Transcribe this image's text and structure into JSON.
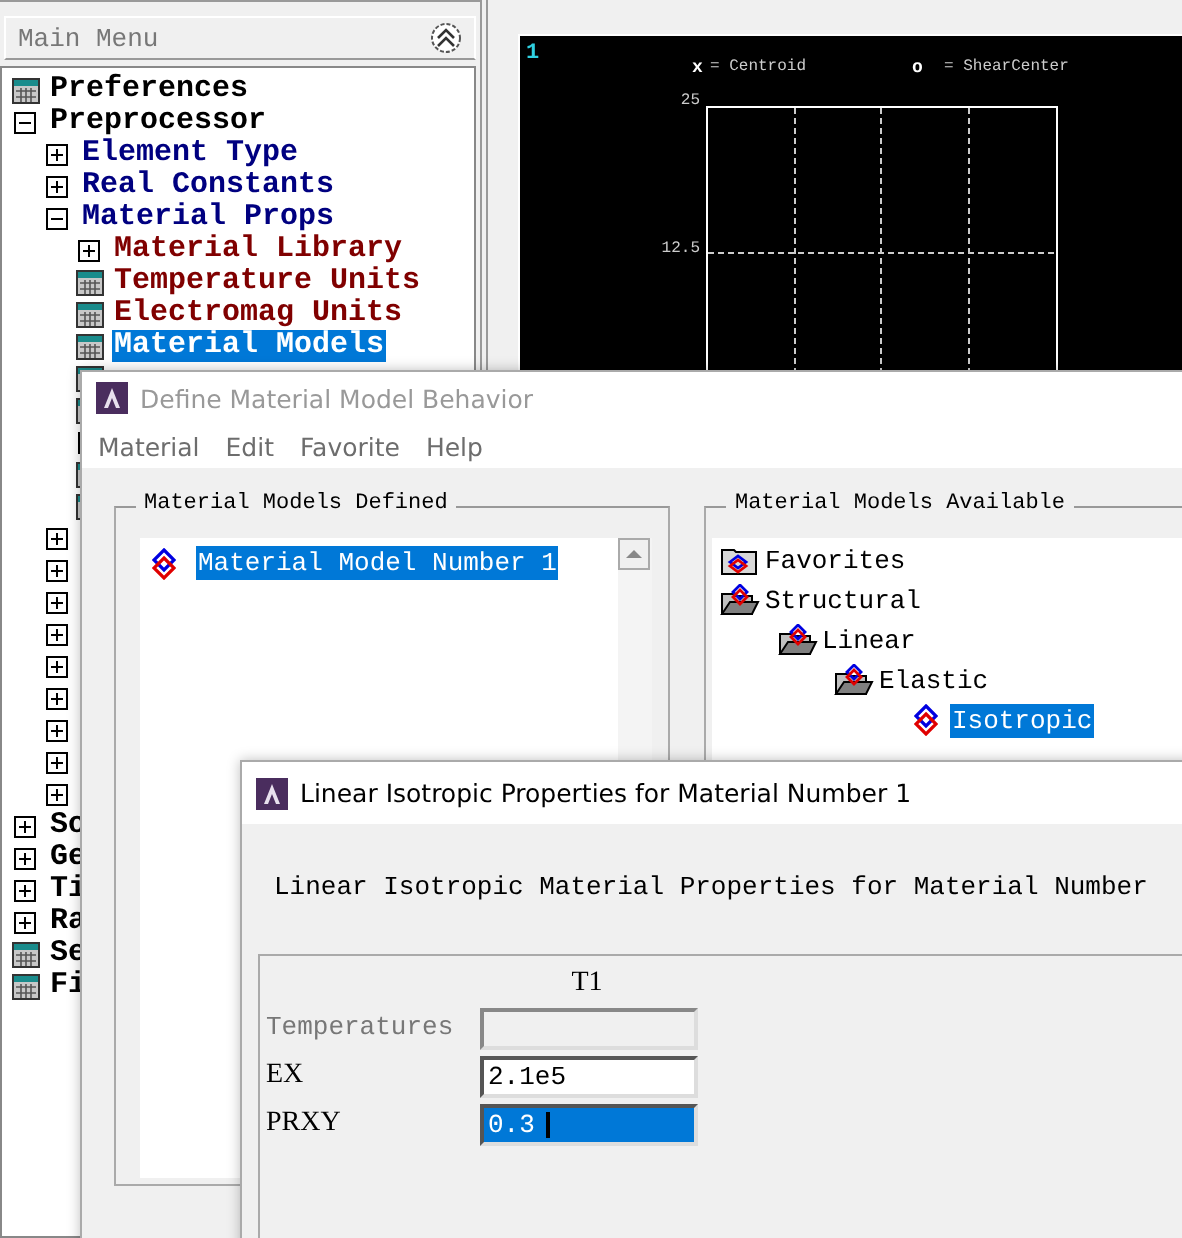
{
  "main_menu": {
    "title": "Main Menu",
    "items": [
      {
        "label": "Preferences",
        "kind": "action",
        "selected": false
      },
      {
        "label": "Preprocessor",
        "kind": "folder",
        "expanded": true,
        "selected": false,
        "children": [
          {
            "label": "Element Type",
            "kind": "folder",
            "expanded": false,
            "selected": false
          },
          {
            "label": "Real Constants",
            "kind": "folder",
            "expanded": false,
            "selected": false
          },
          {
            "label": "Material Props",
            "kind": "folder",
            "expanded": true,
            "selected": false,
            "children": [
              {
                "label": "Material Library",
                "kind": "folder",
                "expanded": false,
                "selected": false
              },
              {
                "label": "Temperature Units",
                "kind": "action",
                "selected": false
              },
              {
                "label": "Electromag Units",
                "kind": "action",
                "selected": false
              },
              {
                "label": "Material Models",
                "kind": "action",
                "selected": true
              },
              {
                "kind": "action"
              },
              {
                "kind": "action"
              },
              {
                "kind": "folder",
                "expanded": false
              },
              {
                "kind": "action"
              },
              {
                "kind": "action"
              }
            ]
          },
          {
            "kind": "folder",
            "expanded": false
          },
          {
            "kind": "folder",
            "expanded": false
          },
          {
            "kind": "folder",
            "expanded": false
          },
          {
            "kind": "folder",
            "expanded": false
          },
          {
            "kind": "folder",
            "expanded": false
          },
          {
            "kind": "folder",
            "expanded": false
          },
          {
            "kind": "folder",
            "expanded": false
          },
          {
            "kind": "folder",
            "expanded": false
          },
          {
            "kind": "folder",
            "expanded": false
          }
        ]
      },
      {
        "label": "So",
        "kind": "folder",
        "expanded": false,
        "selected": false
      },
      {
        "label": "Ge",
        "kind": "folder",
        "expanded": false,
        "selected": false
      },
      {
        "label": "Ti",
        "kind": "folder",
        "expanded": false,
        "selected": false
      },
      {
        "label": "Ra",
        "kind": "folder",
        "expanded": false,
        "selected": false
      },
      {
        "label": "Se",
        "kind": "action",
        "selected": false
      },
      {
        "label": "Fi",
        "kind": "action",
        "selected": false
      }
    ]
  },
  "graphics": {
    "viewport": "1",
    "legend": [
      {
        "symbol": "x",
        "label": "= Centroid"
      },
      {
        "symbol": "o",
        "label": "= ShearCenter"
      }
    ],
    "y_labels": [
      "25",
      "12.5"
    ]
  },
  "material_window": {
    "title": "Define Material Model Behavior",
    "active": false,
    "menu": [
      "Material",
      "Edit",
      "Favorite",
      "Help"
    ],
    "defined": {
      "title": "Material Models Defined",
      "items": [
        {
          "label": "Material Model Number 1",
          "selected": true
        }
      ]
    },
    "available": {
      "title": "Material Models Available",
      "tree": [
        {
          "label": "Favorites",
          "kind": "folder",
          "expanded": false,
          "selected": false
        },
        {
          "label": "Structural",
          "kind": "folder",
          "expanded": true,
          "selected": false,
          "children": [
            {
              "label": "Linear",
              "kind": "folder",
              "expanded": true,
              "selected": false,
              "children": [
                {
                  "label": "Elastic",
                  "kind": "folder",
                  "expanded": true,
                  "selected": false,
                  "children": [
                    {
                      "label": "Isotropic",
                      "kind": "model",
                      "selected": true
                    }
                  ]
                }
              ]
            }
          ]
        }
      ]
    }
  },
  "properties_window": {
    "title": "Linear Isotropic Properties for Material Number 1",
    "active": true,
    "heading": "Linear Isotropic Material Properties for Material Number",
    "columns": [
      "T1"
    ],
    "rows": [
      {
        "label": "Temperatures",
        "disabled": true,
        "selected": false
      },
      {
        "label": "EX",
        "value": "2.1e5",
        "disabled": false,
        "selected": false
      },
      {
        "label": "PRXY",
        "value": "0.3",
        "disabled": false,
        "selected": true
      }
    ]
  }
}
